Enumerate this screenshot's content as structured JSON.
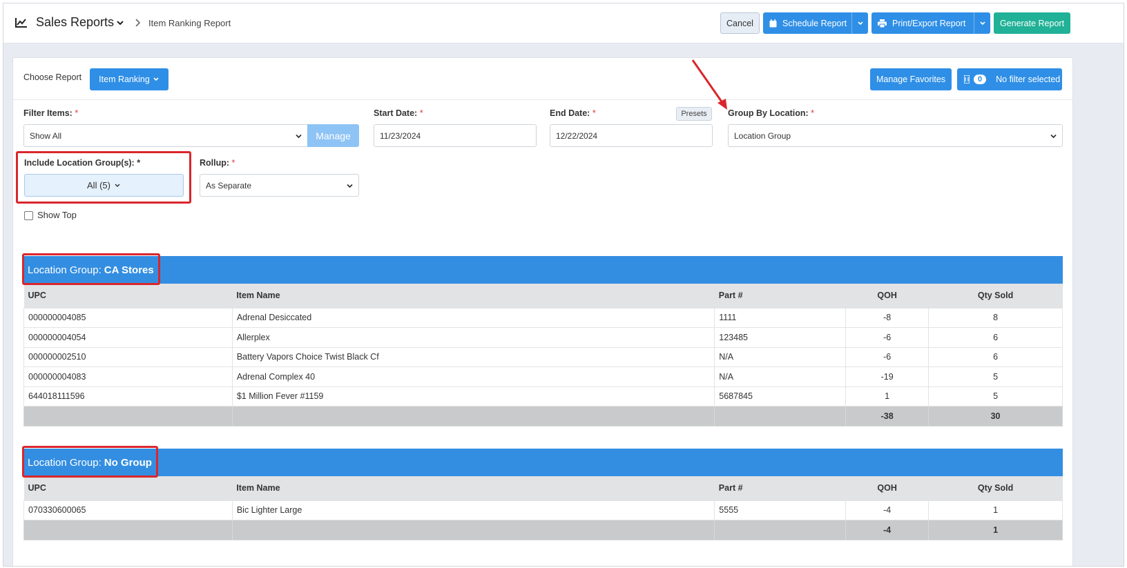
{
  "header": {
    "title": "Sales Reports",
    "breadcrumb": "Item Ranking Report",
    "buttons": {
      "cancel": "Cancel",
      "schedule": "Schedule Report",
      "print_export": "Print/Export Report",
      "generate": "Generate Report"
    }
  },
  "report_bar": {
    "choose_label": "Choose Report",
    "report_select": "Item Ranking",
    "manage_favorites": "Manage Favorites",
    "filter_count": "0",
    "filter_label": "No filter selected"
  },
  "filters": {
    "filter_items": {
      "label": "Filter Items:",
      "value": "Show All",
      "manage_label": "Manage"
    },
    "start_date": {
      "label": "Start Date:",
      "value": "11/23/2024"
    },
    "end_date": {
      "label": "End Date:",
      "value": "12/22/2024",
      "presets_label": "Presets"
    },
    "group_by_location": {
      "label": "Group By Location:",
      "value": "Location Group"
    },
    "include_location_groups": {
      "label": "Include Location Group(s): *",
      "value": "All (5)"
    },
    "rollup": {
      "label": "Rollup:",
      "value": "As Separate"
    },
    "show_top": {
      "label": "Show Top",
      "checked": false
    },
    "required_mark": "*"
  },
  "columns": [
    "UPC",
    "Item Name",
    "Part #",
    "QOH",
    "Qty Sold"
  ],
  "groups": [
    {
      "prefix": "Location Group:",
      "name": "CA Stores",
      "rows": [
        [
          "000000004085",
          "Adrenal Desiccated",
          "1111",
          "-8",
          "8"
        ],
        [
          "000000004054",
          "Allerplex",
          "123485",
          "-6",
          "6"
        ],
        [
          "000000002510",
          "Battery Vapors Choice Twist Black Cf",
          "N/A",
          "-6",
          "6"
        ],
        [
          "000000004083",
          "Adrenal Complex 40",
          "N/A",
          "-19",
          "5"
        ],
        [
          "644018111596",
          "$1 Million Fever #1159",
          "5687845",
          "1",
          "5"
        ]
      ],
      "totals": {
        "qoh": "-38",
        "qty_sold": "30"
      }
    },
    {
      "prefix": "Location Group:",
      "name": "No Group",
      "rows": [
        [
          "070330600065",
          "Bic Lighter Large",
          "5555",
          "-4",
          "1"
        ]
      ],
      "totals": {
        "qoh": "-4",
        "qty_sold": "1"
      }
    }
  ],
  "colors": {
    "primary": "#2f8fe6",
    "generate": "#20b197",
    "group_header": "#338ee1",
    "annotation": "#d9262c"
  }
}
